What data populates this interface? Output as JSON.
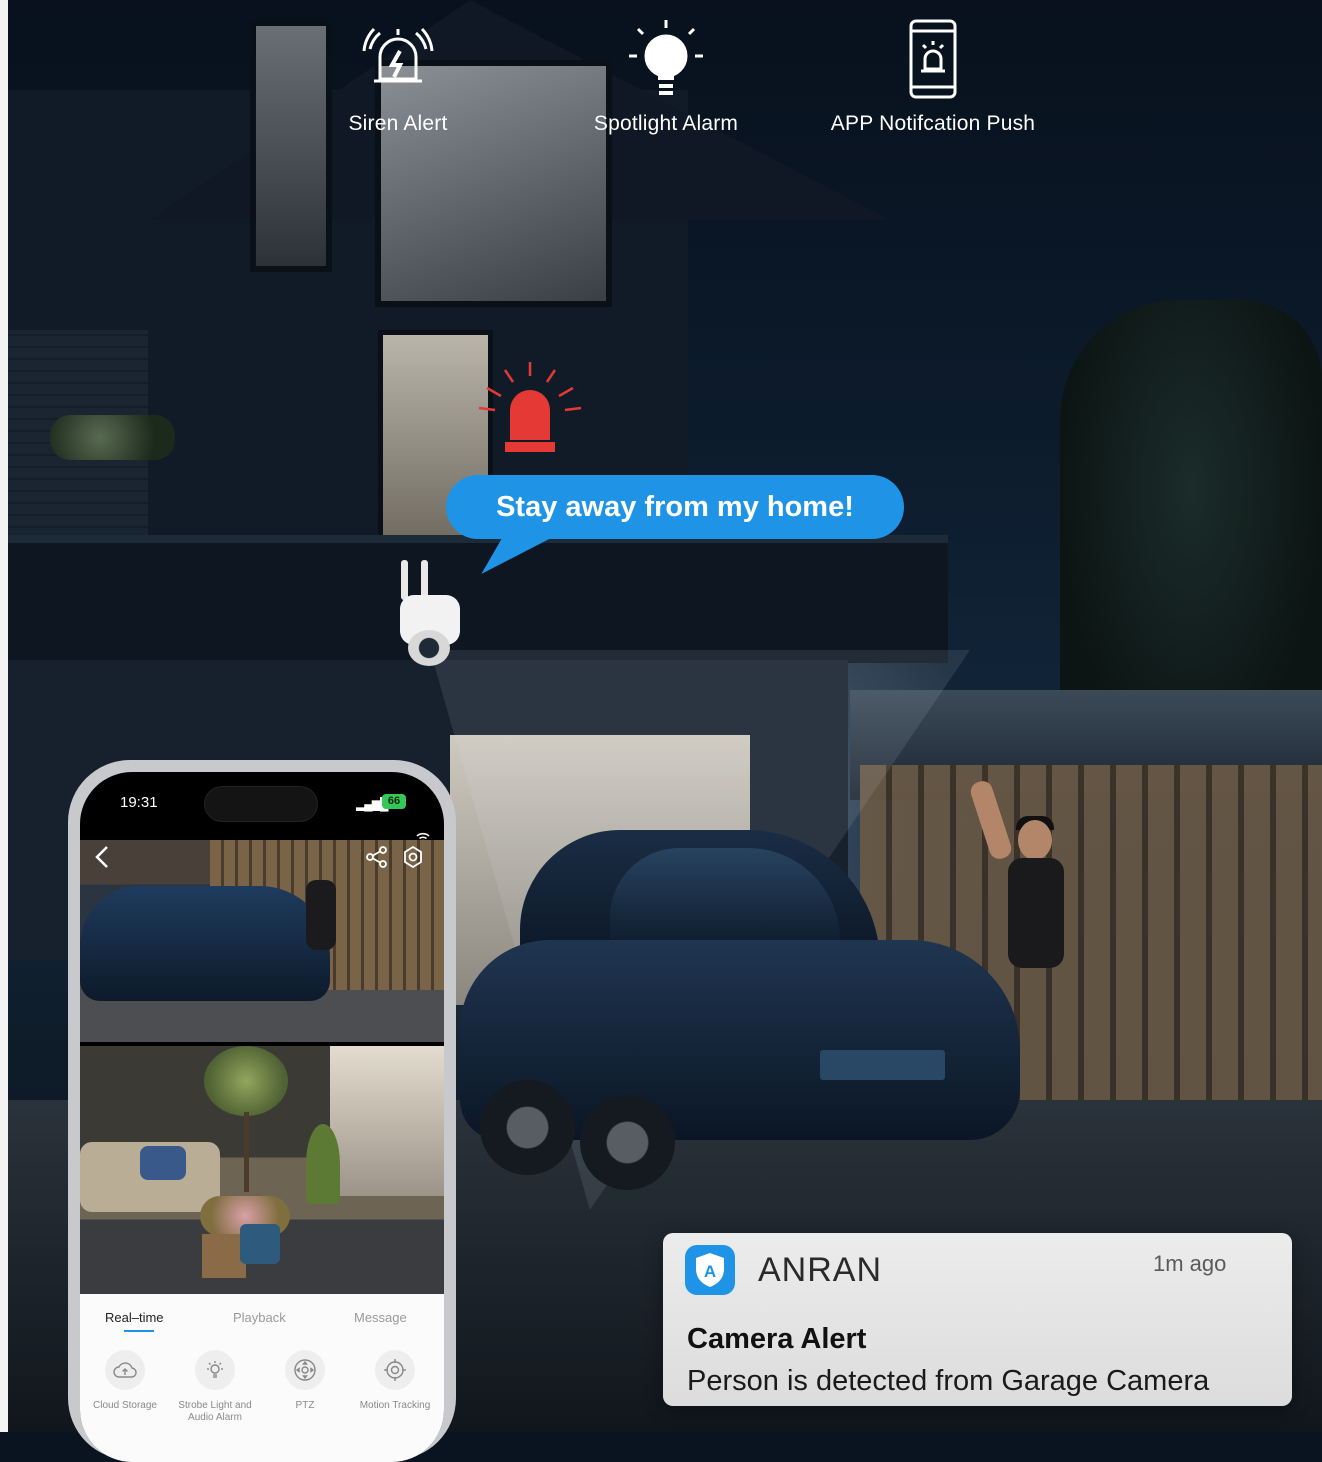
{
  "features": [
    {
      "label": "Siren Alert",
      "icon": "siren-bell-icon"
    },
    {
      "label": "Spotlight Alarm",
      "icon": "light-bulb-icon"
    },
    {
      "label": "APP Notifcation Push",
      "icon": "phone-alarm-icon"
    }
  ],
  "bubble": {
    "text": "Stay away from my home!",
    "color": "#1f94e6"
  },
  "siren": {
    "icon": "red-siren-icon",
    "color": "#e53935"
  },
  "phone": {
    "status": {
      "time": "19:31",
      "battery": "66"
    },
    "feed_nav": {
      "back_icon": "chevron-left-icon",
      "share_icon": "share-icon",
      "settings_icon": "settings-icon"
    },
    "tabs": [
      {
        "label": "Real–time",
        "active": true
      },
      {
        "label": "Playback",
        "active": false
      },
      {
        "label": "Message",
        "active": false
      }
    ],
    "tools": [
      {
        "label": "Cloud Storage",
        "icon": "cloud-upload-icon"
      },
      {
        "label": "Strobe Light and Audio Alarm",
        "icon": "light-bulb-icon"
      },
      {
        "label": "PTZ",
        "icon": "ptz-icon"
      },
      {
        "label": "Motion Tracking",
        "icon": "target-icon"
      }
    ]
  },
  "notification": {
    "app_name": "ANRAN",
    "time": "1m ago",
    "title": "Camera Alert",
    "body": "Person is detected from Garage Camera",
    "app_icon": "shield-a-icon"
  }
}
